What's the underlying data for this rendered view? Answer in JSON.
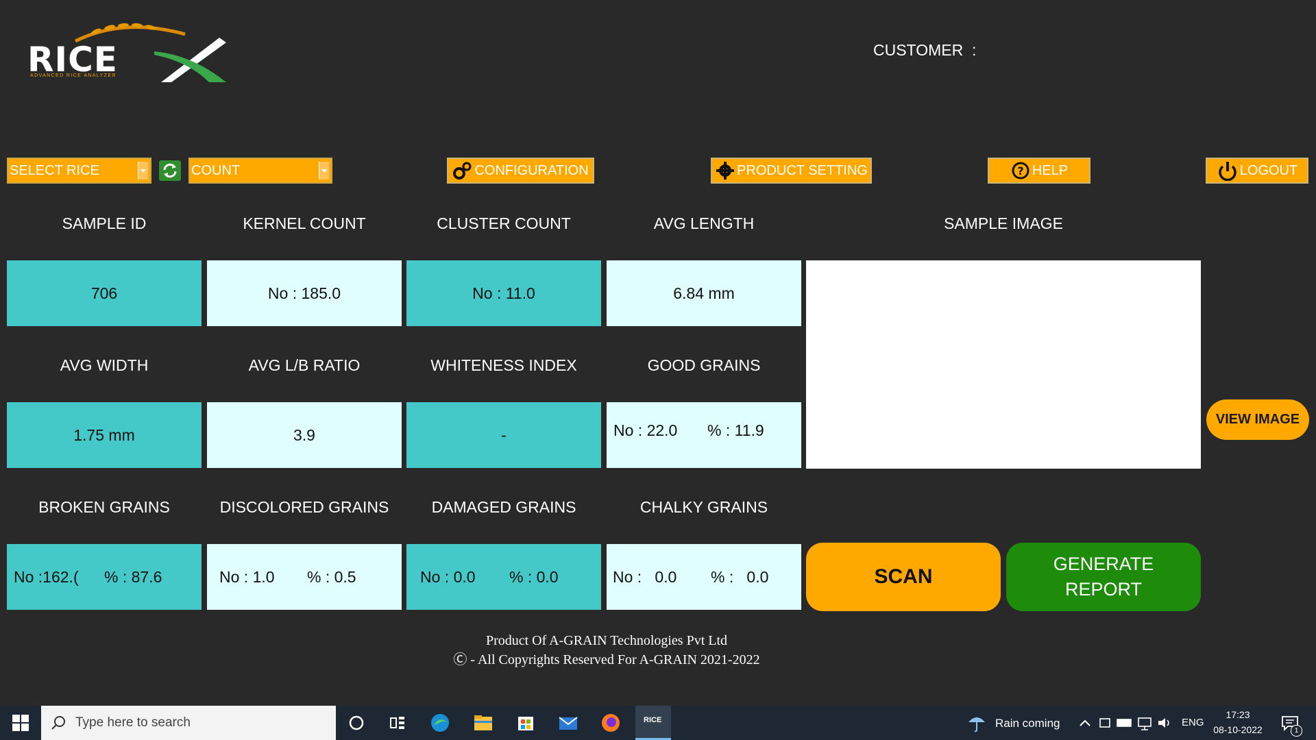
{
  "app": {
    "logo_text": "RICE",
    "logo_subtitle": "ADVANCED RICE ANALYZER"
  },
  "header": {
    "customer_label": "CUSTOMER",
    "customer_colon": ":"
  },
  "toolbar": {
    "select_rice": "SELECT RICE",
    "count": "COUNT",
    "configuration": "CONFIGURATION",
    "product_setting": "PRODUCT SETTING",
    "help": "HELP",
    "logout": "LOGOUT"
  },
  "metrics": {
    "sample_id": {
      "label": "SAMPLE ID",
      "value": "706"
    },
    "kernel_count": {
      "label": "KERNEL COUNT",
      "value": "No : 185.0"
    },
    "cluster_count": {
      "label": "CLUSTER COUNT",
      "value": "No : 11.0"
    },
    "avg_length": {
      "label": "AVG LENGTH",
      "value": "6.84 mm"
    },
    "avg_width": {
      "label": "AVG WIDTH",
      "value": "1.75 mm"
    },
    "avg_lb_ratio": {
      "label": "AVG L/B RATIO",
      "value": "3.9"
    },
    "whiteness_index": {
      "label": "WHITENESS INDEX",
      "value": "-"
    },
    "good_grains": {
      "label": "GOOD GRAINS",
      "no": "No : 22.0",
      "pct": "% : 11.9"
    },
    "broken_grains": {
      "label": "BROKEN GRAINS",
      "no": "No :162.(",
      "pct": "% :  87.6"
    },
    "discolored_grains": {
      "label": "DISCOLORED GRAINS",
      "no": "No : 1.0",
      "pct": "% : 0.5"
    },
    "damaged_grains": {
      "label": "DAMAGED GRAINS",
      "no": "No : 0.0",
      "pct": "% :  0.0"
    },
    "chalky_grains": {
      "label": "CHALKY GRAINS",
      "no": "No :   0.0",
      "pct": "% :   0.0"
    }
  },
  "sample_image": {
    "label": "SAMPLE IMAGE"
  },
  "actions": {
    "view_image": "VIEW IMAGE",
    "scan": "SCAN",
    "generate_line1": "GENERATE",
    "generate_line2": "REPORT"
  },
  "footer": {
    "line1": "Product Of A-GRAIN Technologies Pvt Ltd",
    "line2": "Ⓒ - All Copyrights Reserved For A-GRAIN 2021-2022"
  },
  "taskbar": {
    "search_placeholder": "Type here to search",
    "weather": "Rain coming",
    "language": "ENG",
    "time": "17:23",
    "date": "08-10-2022",
    "notification_count": "1",
    "app_label": "RICE"
  },
  "colors": {
    "background": "#292929",
    "accent_orange": "#ffa800",
    "teal": "#45c8c8",
    "light_cyan": "#e0fefe",
    "green": "#1e8c0a"
  }
}
